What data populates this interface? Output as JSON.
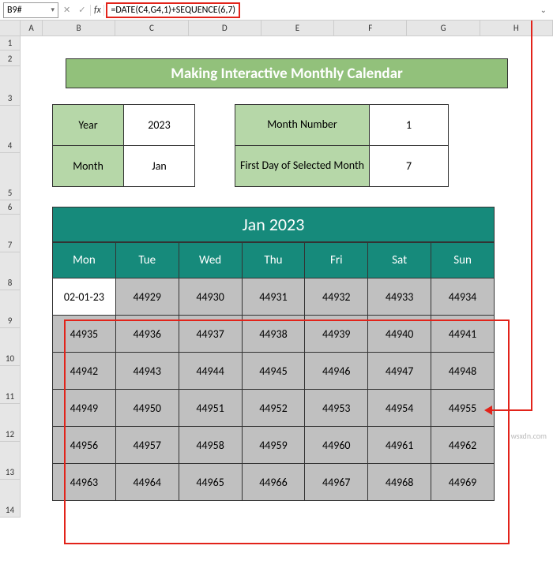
{
  "namebox": "B9#",
  "fx_label": "fx",
  "formula": "=DATE(C4,G4,1)+SEQUENCE(6,7)",
  "columns": [
    "A",
    "B",
    "C",
    "D",
    "E",
    "F",
    "G",
    "H"
  ],
  "rows": [
    "1",
    "2",
    "3",
    "4",
    "5",
    "6",
    "7",
    "8",
    "9",
    "10",
    "11",
    "12",
    "13",
    "14"
  ],
  "title": "Making Interactive Monthly Calendar",
  "year_label": "Year",
  "year_value": "2023",
  "month_label": "Month",
  "month_value": "Jan",
  "monthnum_label": "Month Number",
  "monthnum_value": "1",
  "firstday_label": "First Day of Selected Month",
  "firstday_value": "7",
  "cal_title": "Jan 2023",
  "cal_days": [
    "Mon",
    "Tue",
    "Wed",
    "Thu",
    "Fri",
    "Sat",
    "Sun"
  ],
  "chart_data": {
    "type": "table",
    "title": "Jan 2023",
    "columns": [
      "Mon",
      "Tue",
      "Wed",
      "Thu",
      "Fri",
      "Sat",
      "Sun"
    ],
    "rows": [
      [
        "02-01-23",
        "44929",
        "44930",
        "44931",
        "44932",
        "44933",
        "44934"
      ],
      [
        "44935",
        "44936",
        "44937",
        "44938",
        "44939",
        "44940",
        "44941"
      ],
      [
        "44942",
        "44943",
        "44944",
        "44945",
        "44946",
        "44947",
        "44948"
      ],
      [
        "44949",
        "44950",
        "44951",
        "44952",
        "44953",
        "44954",
        "44955"
      ],
      [
        "44956",
        "44957",
        "44958",
        "44959",
        "44960",
        "44961",
        "44962"
      ],
      [
        "44963",
        "44964",
        "44965",
        "44966",
        "44967",
        "44968",
        "44969"
      ]
    ]
  },
  "watermark": "wsxdn.com"
}
